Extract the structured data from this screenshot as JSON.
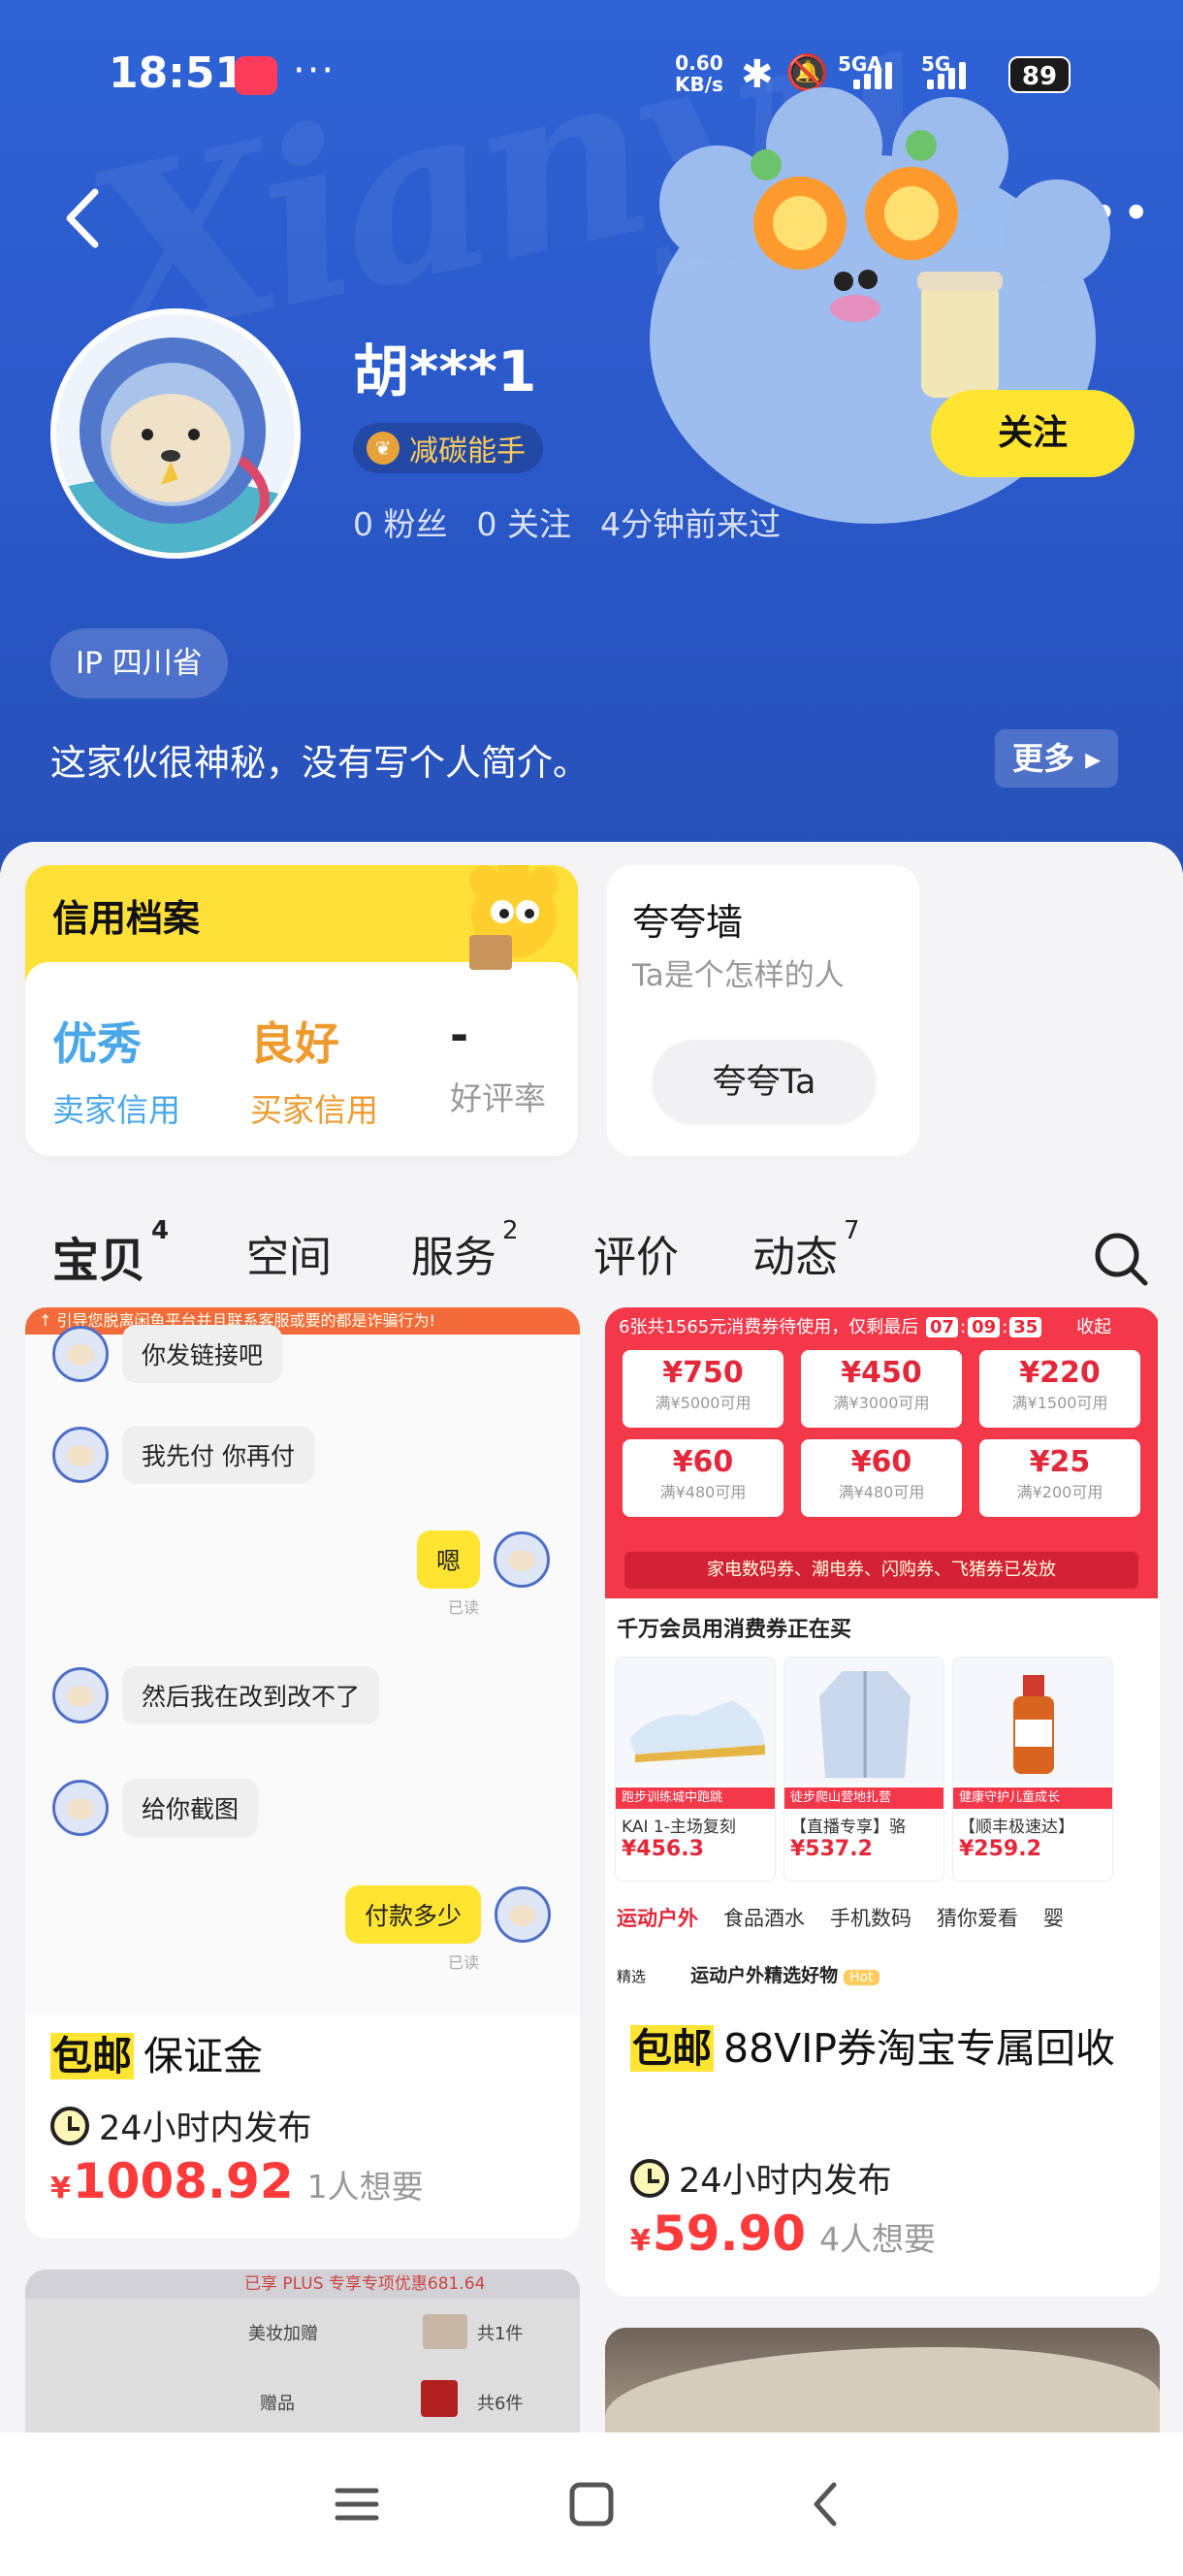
{
  "status_bar": {
    "time": "18:51",
    "dots": "···",
    "net_speed_value": "0.60",
    "net_speed_unit": "KB/s",
    "sim1": "5GA",
    "sim2": "5G",
    "battery": "89"
  },
  "profile": {
    "nickname": "胡***1",
    "badge": "减碳能手",
    "fans": "0 粉丝",
    "following": "0 关注",
    "last_seen": "4分钟前来过",
    "follow_label": "关注",
    "ip": "IP 四川省",
    "bio": "这家伙很神秘，没有写个人简介。",
    "more_label": "更多",
    "watermark": "Xianyu"
  },
  "credit": {
    "title": "信用档案",
    "seller_value": "优秀",
    "seller_label": "卖家信用",
    "buyer_value": "良好",
    "buyer_label": "买家信用",
    "rating_value": "-",
    "rating_label": "好评率"
  },
  "praise": {
    "title": "夸夸墙",
    "subtitle": "Ta是个怎样的人",
    "button": "夸夸Ta"
  },
  "tabs": [
    {
      "label": "宝贝",
      "count": "4"
    },
    {
      "label": "空间",
      "count": ""
    },
    {
      "label": "服务",
      "count": "2"
    },
    {
      "label": "评价",
      "count": ""
    },
    {
      "label": "动态",
      "count": "7"
    }
  ],
  "products": [
    {
      "shipping": "包邮",
      "title": "保证金",
      "time": "24小时内发布",
      "currency": "¥",
      "price": "1008.92",
      "wants": "1人想要",
      "chat": {
        "banner": "↑ 引导您脱离闲鱼平台并且联系客服或要的都是诈骗行为!",
        "m0": "你发链接吧",
        "m1": "我先付 你再付",
        "m2": "嗯",
        "m3": "然后我在改到改不了",
        "m4": "给你截图",
        "m5": "付款多少",
        "read": "已读"
      }
    },
    {
      "shipping": "包邮",
      "title": "88VIP券淘宝专属回收",
      "time": "24小时内发布",
      "currency": "¥",
      "price": "59.90",
      "wants": "4人想要",
      "coupon": {
        "header_pre": "6张共1565元消费券待使用，仅剩最后",
        "t1": "07",
        "t2": "09",
        "t3": "35",
        "collapse": "收起",
        "cells": [
          {
            "amt": "¥750",
            "cond": "满¥5000可用"
          },
          {
            "amt": "¥450",
            "cond": "满¥3000可用"
          },
          {
            "amt": "¥220",
            "cond": "满¥1500可用"
          },
          {
            "amt": "¥60",
            "cond": "满¥480可用"
          },
          {
            "amt": "¥60",
            "cond": "满¥480可用"
          },
          {
            "amt": "¥25",
            "cond": "满¥200可用"
          }
        ],
        "bar": "家电数码券、潮电券、闪购券、飞猪券已发放",
        "sub": "千万会员用消费券正在买",
        "prods": [
          {
            "tag": "跑步训练城中跑跳",
            "name": "KAI 1-主场复刻",
            "price": "¥456.3"
          },
          {
            "tag": "徒步爬山营地扎营",
            "name": "【直播专享】骆",
            "price": "¥537.2"
          },
          {
            "tag": "健康守护儿童成长",
            "name": "【顺丰极速达】",
            "price": "¥259.2"
          }
        ],
        "cats": [
          "运动户外",
          "食品酒水",
          "手机数码",
          "猜你爱看",
          "婴"
        ],
        "row_left": "精选",
        "row_text": "运动户外精选好物",
        "hot": "Hot"
      }
    },
    {
      "plus_banner": "已享 PLUS 专享专项优惠681.64",
      "row1": "美妆加赠",
      "row1_count": "共1件",
      "row2": "赠品",
      "row2_count": "共6件"
    }
  ],
  "colors": {
    "header_blue": "#2c5bcd",
    "follow_yellow": "#ffe431",
    "seller_credit": "#4aa8e8",
    "buyer_credit": "#ee9a2e",
    "price_red": "#ff3a3a"
  },
  "icons": [
    "back-icon",
    "more-icon",
    "leaf-icon",
    "search-icon",
    "clock-icon",
    "menu-icon",
    "home-icon",
    "back-nav-icon"
  ]
}
